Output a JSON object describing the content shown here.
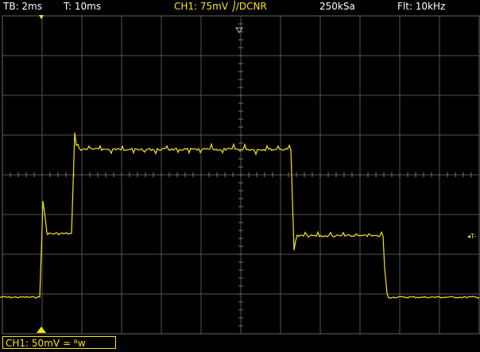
{
  "header": {
    "timebase": "TB: 2ms",
    "trigger_delay": "T: 10ms",
    "trigger_info": "CH1: 75mV ⎠/DCNR",
    "sample_rate": "250kSa",
    "filter": "Flt: 10kHz"
  },
  "channel": {
    "label": "CH1: 50mV ≃ ᴮw"
  },
  "markers": {
    "trigger_level_label": "◂T-"
  },
  "colors": {
    "trace": "#f7e51a",
    "grid": "#555555",
    "background": "#000000"
  }
}
